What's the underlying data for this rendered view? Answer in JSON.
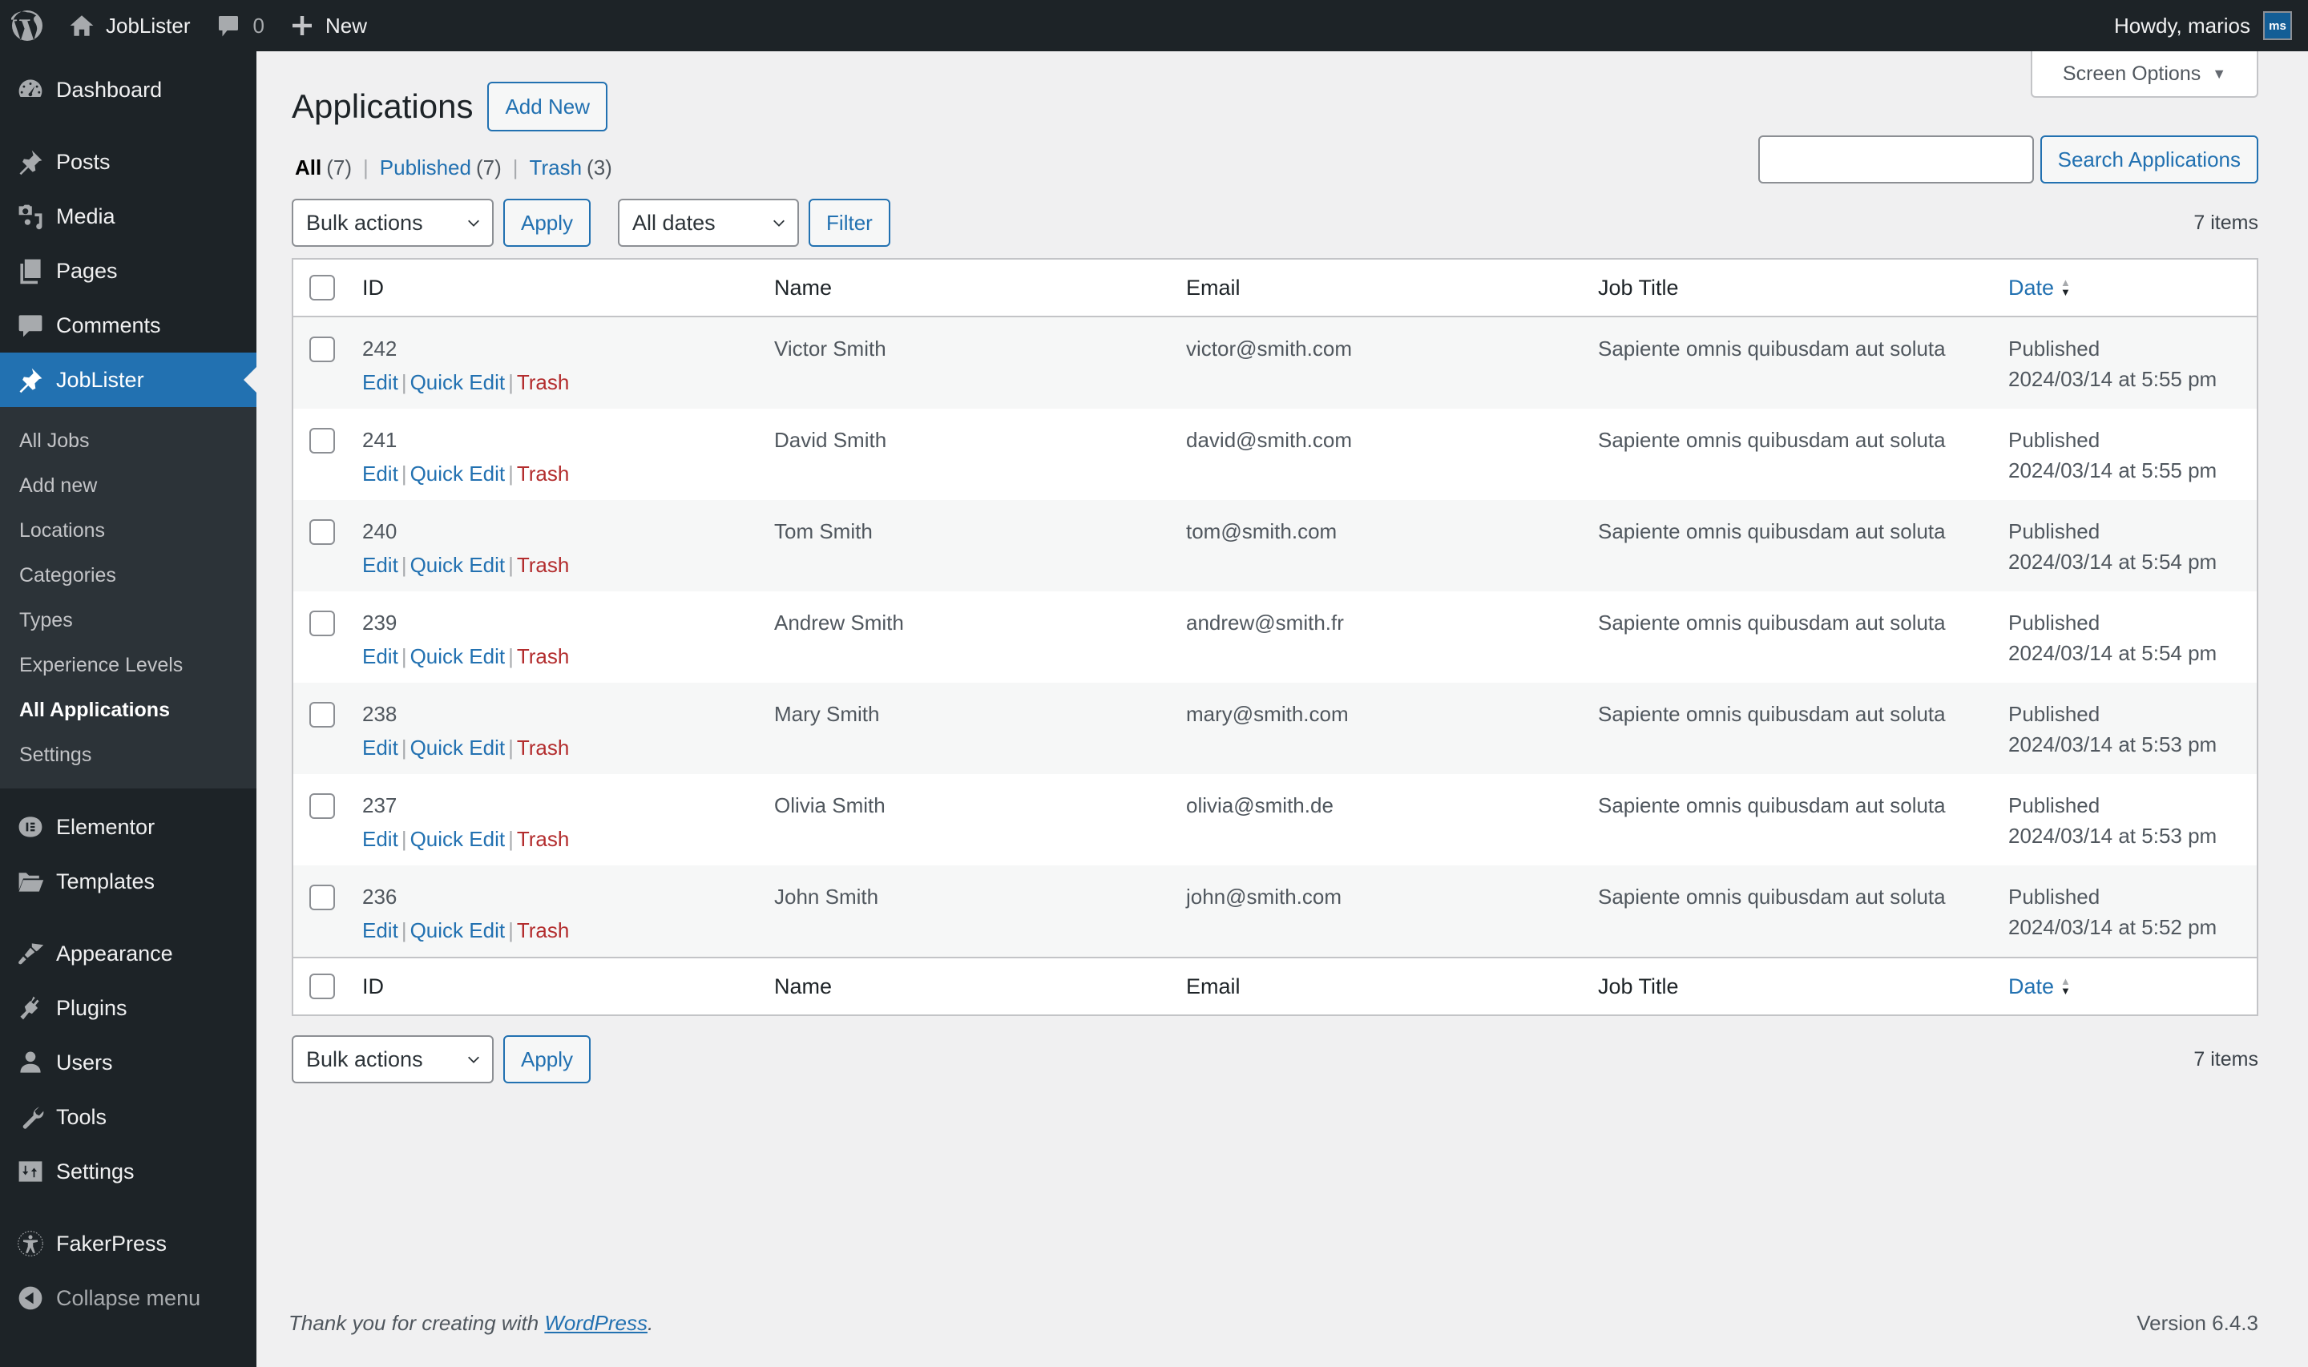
{
  "admin_bar": {
    "site_name": "JobLister",
    "comments_count": "0",
    "new_label": "New",
    "howdy": "Howdy, marios",
    "avatar_initials": "ms"
  },
  "sidebar": {
    "items": [
      {
        "label": "Dashboard",
        "icon": "dashboard-icon"
      },
      {
        "label": "Posts",
        "icon": "pushpin-icon"
      },
      {
        "label": "Media",
        "icon": "media-icon"
      },
      {
        "label": "Pages",
        "icon": "pages-icon"
      },
      {
        "label": "Comments",
        "icon": "comment-icon"
      },
      {
        "label": "JobLister",
        "icon": "pushpin-icon",
        "current": true
      },
      {
        "label": "Elementor",
        "icon": "elementor-icon"
      },
      {
        "label": "Templates",
        "icon": "folder-icon"
      },
      {
        "label": "Appearance",
        "icon": "paintbrush-icon"
      },
      {
        "label": "Plugins",
        "icon": "plugin-icon"
      },
      {
        "label": "Users",
        "icon": "user-icon"
      },
      {
        "label": "Tools",
        "icon": "wrench-icon"
      },
      {
        "label": "Settings",
        "icon": "settings-icon"
      },
      {
        "label": "FakerPress",
        "icon": "accessibility-icon"
      },
      {
        "label": "Collapse menu",
        "icon": "collapse-icon"
      }
    ],
    "submenu": [
      {
        "label": "All Jobs"
      },
      {
        "label": "Add new"
      },
      {
        "label": "Locations"
      },
      {
        "label": "Categories"
      },
      {
        "label": "Types"
      },
      {
        "label": "Experience Levels"
      },
      {
        "label": "All Applications",
        "current": true
      },
      {
        "label": "Settings"
      }
    ]
  },
  "screen_options": "Screen Options",
  "page": {
    "title": "Applications",
    "add_new": "Add New",
    "views": {
      "all": "All",
      "all_count": "(7)",
      "published": "Published",
      "published_count": "(7)",
      "trash": "Trash",
      "trash_count": "(3)"
    },
    "search": {
      "value": "",
      "placeholder": "",
      "button": "Search Applications"
    },
    "bulk_actions": "Bulk actions",
    "apply": "Apply",
    "dates_filter": "All dates",
    "filter": "Filter",
    "items_count": "7 items"
  },
  "table": {
    "columns": [
      "ID",
      "Name",
      "Email",
      "Job Title",
      "Date"
    ],
    "row_actions": {
      "edit": "Edit",
      "quick_edit": "Quick Edit",
      "trash": "Trash"
    },
    "rows": [
      {
        "id": "242",
        "name": "Victor Smith",
        "email": "victor@smith.com",
        "job": "Sapiente omnis quibusdam aut soluta",
        "status": "Published",
        "date": "2024/03/14 at 5:55 pm"
      },
      {
        "id": "241",
        "name": "David Smith",
        "email": "david@smith.com",
        "job": "Sapiente omnis quibusdam aut soluta",
        "status": "Published",
        "date": "2024/03/14 at 5:55 pm"
      },
      {
        "id": "240",
        "name": "Tom Smith",
        "email": "tom@smith.com",
        "job": "Sapiente omnis quibusdam aut soluta",
        "status": "Published",
        "date": "2024/03/14 at 5:54 pm"
      },
      {
        "id": "239",
        "name": "Andrew Smith",
        "email": "andrew@smith.fr",
        "job": "Sapiente omnis quibusdam aut soluta",
        "status": "Published",
        "date": "2024/03/14 at 5:54 pm"
      },
      {
        "id": "238",
        "name": "Mary Smith",
        "email": "mary@smith.com",
        "job": "Sapiente omnis quibusdam aut soluta",
        "status": "Published",
        "date": "2024/03/14 at 5:53 pm"
      },
      {
        "id": "237",
        "name": "Olivia Smith",
        "email": "olivia@smith.de",
        "job": "Sapiente omnis quibusdam aut soluta",
        "status": "Published",
        "date": "2024/03/14 at 5:53 pm"
      },
      {
        "id": "236",
        "name": "John Smith",
        "email": "john@smith.com",
        "job": "Sapiente omnis quibusdam aut soluta",
        "status": "Published",
        "date": "2024/03/14 at 5:52 pm"
      }
    ]
  },
  "footer": {
    "thanks_prefix": "Thank you for creating with ",
    "thanks_link": "WordPress",
    "thanks_suffix": ".",
    "version": "Version 6.4.3"
  },
  "colors": {
    "accent": "#2271b1",
    "admin_bg": "#1d2327",
    "trash": "#b32d2e"
  }
}
